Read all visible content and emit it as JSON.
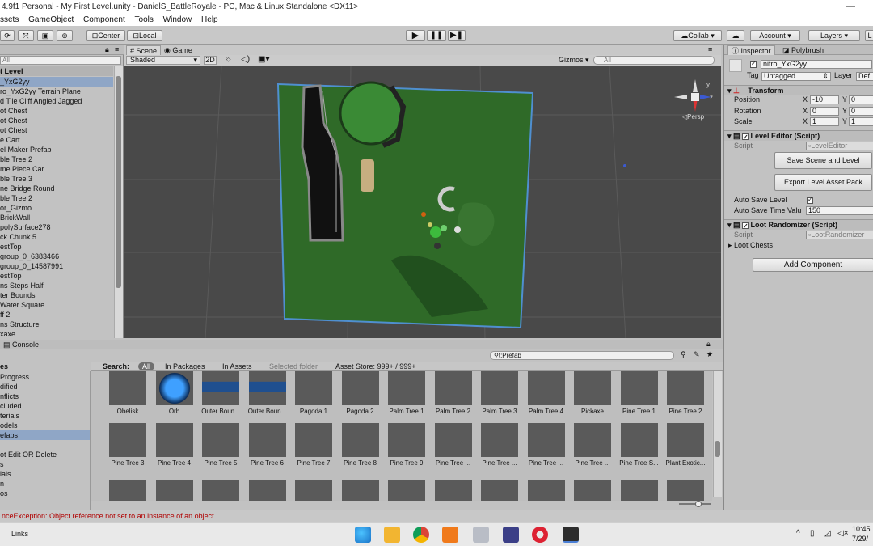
{
  "window": {
    "title": "4.9f1 Personal - My First Level.unity - DanielS_BattleRoyale - PC, Mac & Linux Standalone <DX11>",
    "minimize": "—"
  },
  "menu": [
    "ssets",
    "GameObject",
    "Component",
    "Tools",
    "Window",
    "Help"
  ],
  "toolbar": {
    "center_label": "Center",
    "local_label": "Local",
    "collab_label": "Collab ▾",
    "account_label": "Account ▾",
    "layers_label": "Layers ▾",
    "layout_label": "L"
  },
  "hierarchy": {
    "search_placeholder": "All",
    "scene_title": "t Level",
    "items": [
      "_YxG2yy",
      "ro_YxG2yy Terrain Plane",
      "d Tile Cliff Angled Jagged",
      "ot Chest",
      "ot Chest",
      "ot Chest",
      "e Cart",
      "el Maker Prefab",
      "ble Tree 2",
      "me Piece Car",
      "ble Tree 3",
      "ne Bridge Round",
      "ble Tree 2",
      "or_Gizmo",
      "BrickWall",
      "polySurface278",
      "ck Chunk 5",
      "estTop",
      "group_0_6383466",
      "group_0_14587991",
      "estTop",
      "ns Steps Half",
      "ter Bounds",
      "Water Square",
      "ff 2",
      "ns Structure",
      "xaxe"
    ],
    "selected_index": 0
  },
  "scene": {
    "tab_scene": "Scene",
    "tab_game": "Game",
    "shading": "Shaded",
    "mode_2d": "2D",
    "gizmos": "Gizmos ▾",
    "search_placeholder": "All",
    "persp_label": "◁Persp",
    "axis_y": "y",
    "axis_z": "z"
  },
  "inspector": {
    "tab_inspector": "Inspector",
    "tab_polybrush": "Polybrush",
    "object_name": "nitro_YxG2yy",
    "tag_label": "Tag",
    "tag_value": "Untagged",
    "layer_label": "Layer",
    "layer_value": "Def",
    "transform": {
      "title": "Transform",
      "position_label": "Position",
      "rotation_label": "Rotation",
      "scale_label": "Scale",
      "position": [
        "-10",
        "0"
      ],
      "rotation": [
        "0",
        "0"
      ],
      "scale": [
        "1",
        "1"
      ],
      "x_label": "X",
      "y_label": "Y"
    },
    "level_editor": {
      "title": "Level Editor (Script)",
      "script_label": "Script",
      "script_value": "LevelEditor",
      "save_button": "Save Scene and Level",
      "export_button": "Export Level Asset Pack",
      "autosave_label": "Auto Save Level",
      "autosave_checked": true,
      "autosave_time_label": "Auto Save Time Valu",
      "autosave_time_value": "150"
    },
    "loot_randomizer": {
      "title": "Loot Randomizer (Script)",
      "script_label": "Script",
      "script_value": "LootRandomizer",
      "loot_chests_label": "Loot Chests"
    },
    "add_component": "Add Component"
  },
  "project": {
    "console_tab": "Console",
    "search_value": "t:Prefab",
    "search_label": "Search:",
    "filter_all": "All",
    "filter_packages": "In Packages",
    "filter_assets": "In Assets",
    "filter_folder": "Selected folder",
    "filter_store": "Asset Store: 999+ / 999+",
    "tree_title": "es",
    "tree": [
      "Progress",
      "dified",
      "nflicts",
      "cluded",
      "terials",
      "odels",
      "efabs",
      "",
      "ot Edit OR Delete",
      "s",
      "ials",
      "n",
      "os"
    ],
    "tree_selected": 6,
    "assets_row1": [
      "Obelisk",
      "Orb",
      "Outer Boun...",
      "Outer Boun...",
      "Pagoda 1",
      "Pagoda 2",
      "Palm Tree 1",
      "Palm Tree 2",
      "Palm Tree 3",
      "Palm Tree 4",
      "Pickaxe",
      "Pine Tree 1",
      "Pine Tree 2"
    ],
    "assets_row2": [
      "Pine Tree 3",
      "Pine Tree 4",
      "Pine Tree 5",
      "Pine Tree 6",
      "Pine Tree 7",
      "Pine Tree 8",
      "Pine Tree 9",
      "Pine Tree ...",
      "Pine Tree ...",
      "Pine Tree ...",
      "Pine Tree ...",
      "Pine Tree S...",
      "Plant Exotic..."
    ]
  },
  "status": {
    "error": "nceException: Object reference not set to an instance of an object"
  },
  "taskbar": {
    "links": "Links",
    "time": "10:45",
    "date": "7/29/"
  },
  "colors": {
    "terrain": "#2f6b2a",
    "terrain_outline": "#4f8fd0",
    "selection": "#8fa6c6",
    "error_text": "#b00000"
  }
}
